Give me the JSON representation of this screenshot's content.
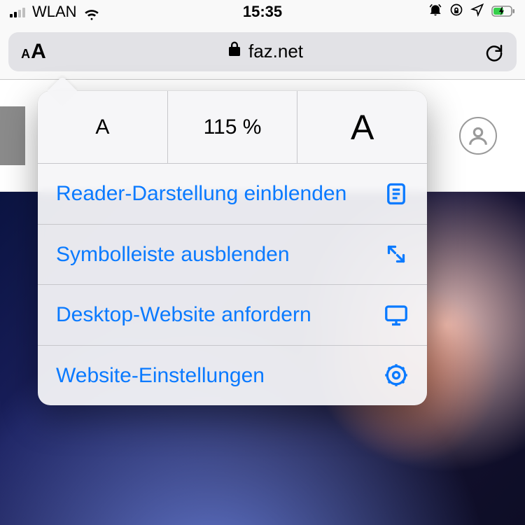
{
  "status": {
    "carrier": "WLAN",
    "time": "15:35"
  },
  "urlbar": {
    "domain": "faz.net"
  },
  "popover": {
    "font_small_glyph": "A",
    "font_percent": "115 %",
    "font_large_glyph": "A",
    "items": [
      {
        "label": "Reader-Darstellung einblenden"
      },
      {
        "label": "Symbolleiste ausblenden"
      },
      {
        "label": "Desktop-Website anfordern"
      },
      {
        "label": "Website-Einstellungen"
      }
    ]
  }
}
